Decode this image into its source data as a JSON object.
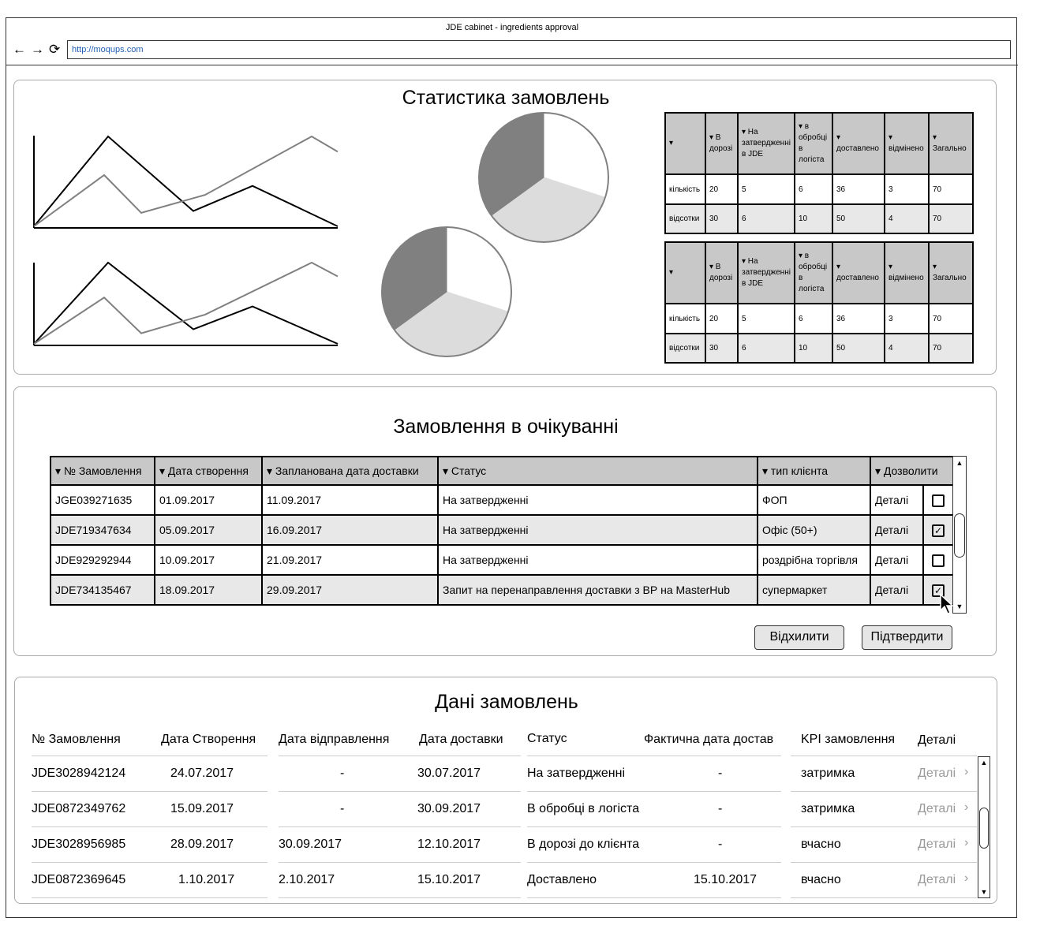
{
  "browser": {
    "title": "JDE cabinet - ingredients approval",
    "url": "http://moqups.com",
    "back_icon": "←",
    "forward_icon": "→",
    "reload_icon": "⟳"
  },
  "stats": {
    "title": "Статистика замовлень",
    "table": {
      "headers": [
        "▾",
        "▾ В дорозі",
        "▾ На затвердженні в JDE",
        "▾ в обробці в логіста",
        "▾ доставлено",
        "▾ відмінено",
        "▾ Загально"
      ],
      "rows": [
        [
          "кількість",
          "20",
          "5",
          "6",
          "36",
          "3",
          "70"
        ],
        [
          "відсотки",
          "30",
          "6",
          "10",
          "50",
          "4",
          "70"
        ]
      ]
    },
    "line_charts": [
      {
        "series": [
          {
            "values": [
              0,
              100,
              17,
              45,
              0
            ]
          },
          {
            "values": [
              0,
              57,
              15,
              35,
              100,
              83
            ]
          }
        ]
      },
      {
        "series": [
          {
            "values": [
              0,
              100,
              18,
              46,
              0
            ]
          },
          {
            "values": [
              0,
              57,
              13,
              36,
              100,
              83
            ]
          }
        ]
      }
    ],
    "pies": [
      {
        "slices": [
          0.3,
          0.35,
          0.35
        ]
      },
      {
        "slices": [
          0.3,
          0.35,
          0.35
        ]
      }
    ],
    "colors": {
      "dark_gray": "#808080",
      "light_gray": "#dcdcdc",
      "header_gray": "#c8c8c8"
    }
  },
  "pending": {
    "title": "Замовлення в очікуванні",
    "headers": [
      "▾ № Замовлення",
      "▾ Дата створення",
      "▾ Запланована дата доставки",
      "▾ Статус",
      "▾ тип клієнта",
      "▾ Дозволити"
    ],
    "rows": [
      {
        "id": "JGE039271635",
        "created": "01.09.2017",
        "planned": "11.09.2017",
        "status": "На затвердженні",
        "client": "ФОП",
        "details": "Деталі",
        "checked": false
      },
      {
        "id": "JDE719347634",
        "created": "05.09.2017",
        "planned": "16.09.2017",
        "status": "На затвердженні",
        "client": "Офіс (50+)",
        "details": "Деталі",
        "checked": true
      },
      {
        "id": "JDE929292944",
        "created": "10.09.2017",
        "planned": "21.09.2017",
        "status": "На затвердженні",
        "client": "роздрібна торгівля",
        "details": "Деталі",
        "checked": false
      },
      {
        "id": "JDE734135467",
        "created": "18.09.2017",
        "planned": "29.09.2017",
        "status": "Запит на перенаправлення доставки з ВР на MasterHub",
        "client": "супермаркет",
        "details": "Деталі",
        "checked": true
      }
    ],
    "reject_label": "Відхилити",
    "confirm_label": "Підтвердити"
  },
  "orders": {
    "title": "Дані замовлень",
    "headers": [
      "№ Замовлення",
      "Дата Створення",
      "Дата відправлення",
      "Дата доставки",
      "Статус",
      "Фактична дата достав",
      "KPI замовлення",
      "Деталі"
    ],
    "rows": [
      {
        "id": "JDE3028942124",
        "created": "24.07.2017",
        "shipped": "-",
        "delivery": "30.07.2017",
        "status": "На затвердженні",
        "actual": "-",
        "kpi": "затримка",
        "details": "Деталі"
      },
      {
        "id": "JDE0872349762",
        "created": "15.09.2017",
        "shipped": "-",
        "delivery": "30.09.2017",
        "status": "В обробці в логіста",
        "actual": "-",
        "kpi": "затримка",
        "details": "Деталі"
      },
      {
        "id": "JDE3028956985",
        "created": "28.09.2017",
        "shipped": "30.09.2017",
        "delivery": "12.10.2017",
        "status": "В дорозі до клієнта",
        "actual": "-",
        "kpi": "вчасно",
        "details": "Деталі"
      },
      {
        "id": "JDE0872369645",
        "created": "1.10.2017",
        "shipped": "2.10.2017",
        "delivery": "15.10.2017",
        "status": "Доставлено",
        "actual": "15.10.2017",
        "kpi": "вчасно",
        "details": "Деталі"
      }
    ]
  }
}
